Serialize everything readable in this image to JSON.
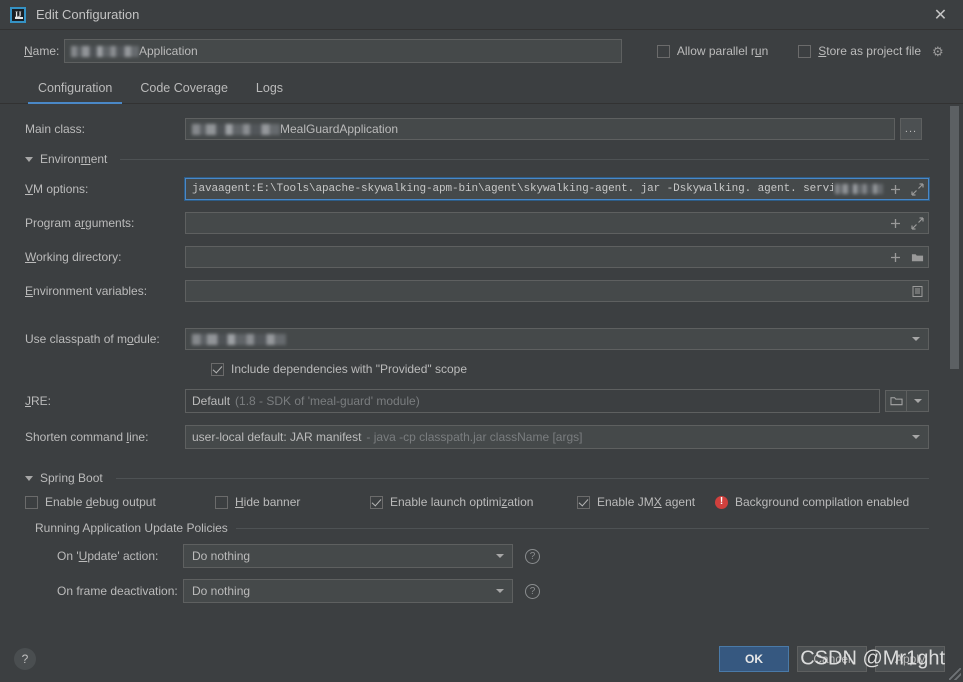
{
  "window": {
    "title": "Edit Configuration",
    "app_icon": "intellij-idea-icon",
    "close_label": "✕"
  },
  "name_row": {
    "label": "Name:",
    "label_mnemonic": "N",
    "value_visible_suffix": "Application",
    "value_redacted": true,
    "allow_parallel_run": {
      "label": "Allow parallel run",
      "checked": false
    },
    "store_as_project_file": {
      "label": "Store as project file",
      "checked": false
    },
    "gear_icon": "gear-icon"
  },
  "tabs": [
    {
      "label": "Configuration",
      "active": true
    },
    {
      "label": "Code Coverage",
      "active": false
    },
    {
      "label": "Logs",
      "active": false
    }
  ],
  "main_class": {
    "label": "Main class:",
    "value_visible_suffix": "MealGuardApplication",
    "value_redacted": true,
    "browse_button_label": "..."
  },
  "environment_section": {
    "title": "Environment",
    "expanded": true,
    "vm_options": {
      "label": "VM options:",
      "label_mnemonic": "V",
      "value": "javaagent:E:\\Tools\\apache-skywalking-apm-bin\\agent\\skywalking-agent. jar -Dskywalking. agent. service_name=",
      "value_has_redacted_tail": true,
      "focused": true,
      "icons": [
        "plus-icon",
        "expand-icon"
      ]
    },
    "program_arguments": {
      "label": "Program arguments:",
      "label_mnemonic": "r",
      "value": "",
      "icons": [
        "plus-icon",
        "expand-icon"
      ]
    },
    "working_directory": {
      "label": "Working directory:",
      "label_mnemonic": "W",
      "value": "",
      "icons": [
        "plus-icon",
        "folder-icon"
      ]
    },
    "environment_variables": {
      "label": "Environment variables:",
      "label_mnemonic": "E",
      "value": "",
      "icons": [
        "list-icon"
      ]
    }
  },
  "classpath": {
    "use_classpath_of_module": {
      "label": "Use classpath of module:",
      "label_mnemonic": "o",
      "value_redacted": true,
      "dropdown_icon": "chevron-down-icon"
    },
    "include_provided_scope": {
      "label": "Include dependencies with \"Provided\" scope",
      "checked": true
    },
    "jre": {
      "label": "JRE:",
      "label_mnemonic": "J",
      "value": "Default",
      "value_hint": "(1.8 - SDK of 'meal-guard' module)",
      "icons": [
        "folder-icon",
        "chevron-down-icon"
      ]
    },
    "shorten_command_line": {
      "label": "Shorten command line:",
      "label_mnemonic": "l",
      "value": "user-local default: JAR manifest",
      "value_hint": "- java -cp classpath.jar className [args]",
      "dropdown_icon": "chevron-down-icon"
    }
  },
  "spring_boot_section": {
    "title": "Spring Boot",
    "expanded": true,
    "checkboxes": [
      {
        "label": "Enable debug output",
        "checked": false,
        "mnemonic": "d"
      },
      {
        "label": "Hide banner",
        "checked": false,
        "mnemonic": "H"
      },
      {
        "label": "Enable launch optimization",
        "checked": true,
        "mnemonic": "z"
      },
      {
        "label": "Enable JMX agent",
        "checked": true,
        "mnemonic": "X"
      }
    ],
    "warning": {
      "icon": "error-icon",
      "text": "Background compilation enabled",
      "color": "#d0403d"
    }
  },
  "update_policies": {
    "title": "Running Application Update Policies",
    "rows": [
      {
        "label": "On 'Update' action:",
        "label_mnemonic": "U",
        "value": "Do nothing",
        "help_icon": "help-icon"
      },
      {
        "label": "On frame deactivation:",
        "value": "Do nothing",
        "help_icon": "help-icon"
      }
    ]
  },
  "footer": {
    "help_button": "?",
    "ok_label": "OK",
    "cancel_label": "Cancel",
    "apply_label": "Apply",
    "watermark": "CSDN @Mr1ght"
  },
  "colors": {
    "background": "#3c3f41",
    "field_background": "#45494a",
    "border": "#5e6060",
    "accent": "#4a88c7",
    "primary_button": "#365880",
    "error": "#d0403d",
    "text": "#bbbbbb",
    "muted_text": "#7a7d7f"
  }
}
